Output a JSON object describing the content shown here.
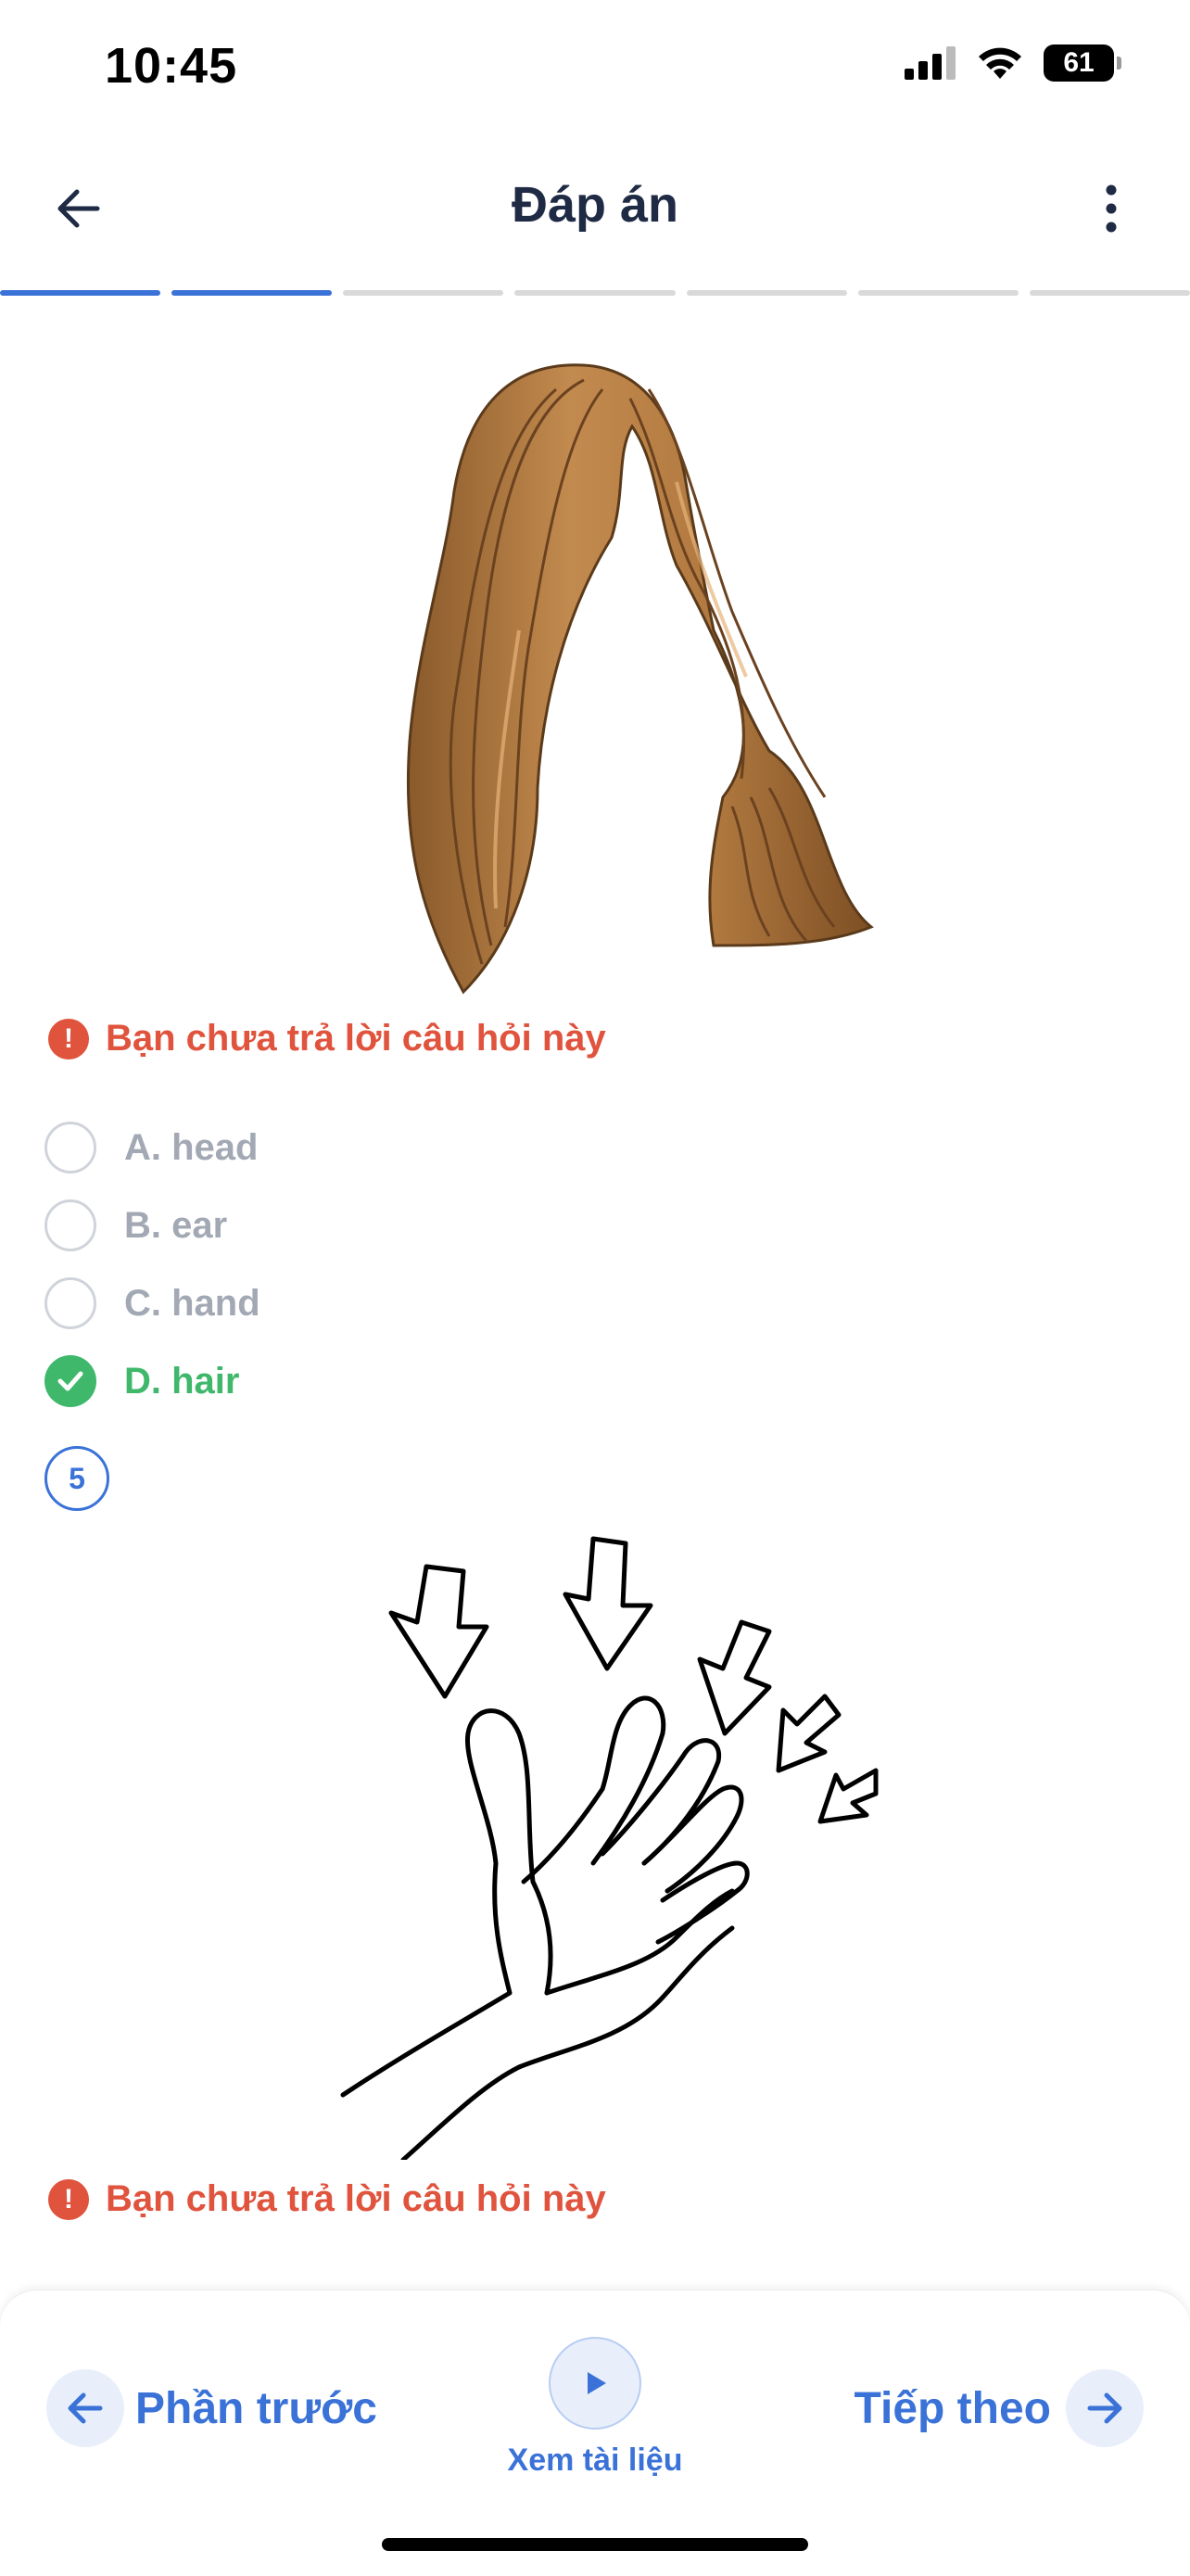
{
  "status_bar": {
    "time": "10:45",
    "battery": "61"
  },
  "header": {
    "title": "Đáp án"
  },
  "progress": {
    "total": 7,
    "completed": 2
  },
  "question_4": {
    "image": "hair-illustration",
    "warning": "Bạn chưa trả lời câu hỏi này",
    "options": [
      {
        "label": "A. head",
        "state": "unselected"
      },
      {
        "label": "B. ear",
        "state": "unselected"
      },
      {
        "label": "C. hand",
        "state": "unselected"
      },
      {
        "label": "D. hair",
        "state": "correct"
      }
    ]
  },
  "question_5": {
    "number": "5",
    "image": "hand-fingers-illustration",
    "warning": "Bạn chưa trả lời câu hỏi này"
  },
  "bottom_bar": {
    "prev_label": "Phần trước",
    "doc_label": "Xem tài liệu",
    "next_label": "Tiếp theo"
  },
  "colors": {
    "accent": "#3a72d8",
    "error": "#e0533d",
    "correct": "#3fb86b"
  }
}
